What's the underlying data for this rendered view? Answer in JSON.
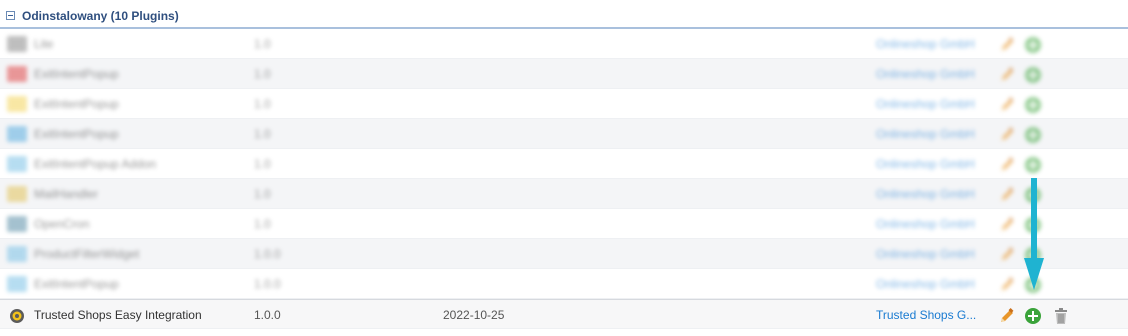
{
  "group": {
    "title": "Odinstalowany (10 Plugins)"
  },
  "blurred_rows": [
    {
      "name": "Lite",
      "version": "1.0",
      "date": "",
      "author": "Onlineshop GmbH",
      "icon_color": "#8a8a8a"
    },
    {
      "name": "ExitIntentPopup",
      "version": "1.0",
      "date": "",
      "author": "Onlineshop GmbH",
      "icon_color": "#e04a4a"
    },
    {
      "name": "ExitIntentPopup",
      "version": "1.0",
      "date": "",
      "author": "Onlineshop GmbH",
      "icon_color": "#f3d45a"
    },
    {
      "name": "ExitIntentPopup",
      "version": "1.0",
      "date": "",
      "author": "Onlineshop GmbH",
      "icon_color": "#5aaee0"
    },
    {
      "name": "ExitIntentPopup Addon",
      "version": "1.0",
      "date": "",
      "author": "Onlineshop GmbH",
      "icon_color": "#7cc2e6"
    },
    {
      "name": "MailHandler",
      "version": "1.0",
      "date": "",
      "author": "Onlineshop GmbH",
      "icon_color": "#e2c35a"
    },
    {
      "name": "OpenCron",
      "version": "1.0",
      "date": "",
      "author": "Onlineshop GmbH",
      "icon_color": "#5a8fa8"
    },
    {
      "name": "ProductFilterWidget",
      "version": "1.0.0",
      "date": "",
      "author": "Onlineshop GmbH",
      "icon_color": "#7cc2e6"
    },
    {
      "name": "ExitIntentPopup",
      "version": "1.0.0",
      "date": "",
      "author": "Onlineshop GmbH",
      "icon_color": "#7cc2e6"
    }
  ],
  "target_row": {
    "name": "Trusted Shops Easy Integration",
    "version": "1.0.0",
    "date": "2022-10-25",
    "author": "Trusted Shops G..."
  },
  "colors": {
    "edit": "#e8962b",
    "install": "#3aa33a",
    "delete": "#8a8a8a",
    "arrow": "#1fb3d1",
    "author_link": "#1a7bd1"
  },
  "icons": {
    "edit": "pencil-icon",
    "install": "plus-circle-icon",
    "delete": "trash-icon",
    "plugin": "plugin-badge-icon"
  }
}
